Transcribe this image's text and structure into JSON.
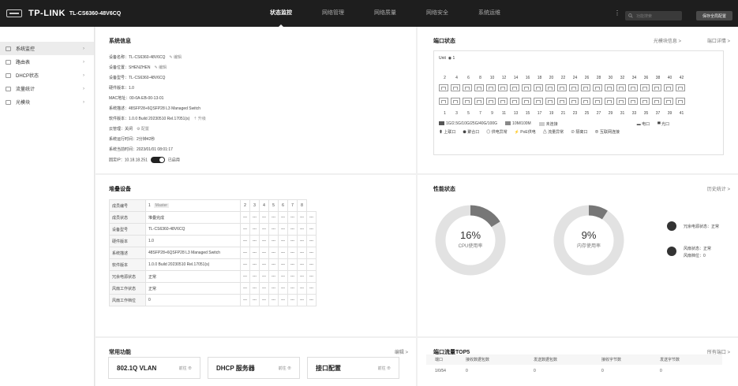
{
  "header": {
    "brand": "TP-LINK",
    "model": "TL-CS6360-48V6CQ",
    "nav": [
      "状态监控",
      "网络管理",
      "网络质量",
      "网络安全",
      "系统运维"
    ],
    "search_placeholder": "功能搜索",
    "save_label": "保存全局配置"
  },
  "sidebar": {
    "items": [
      {
        "label": "系统监控",
        "icon": "monitor-icon"
      },
      {
        "label": "路由表",
        "icon": "route-table-icon"
      },
      {
        "label": "DHCP状态",
        "icon": "dhcp-icon"
      },
      {
        "label": "流量统计",
        "icon": "traffic-icon"
      },
      {
        "label": "光模块",
        "icon": "optical-module-icon"
      }
    ]
  },
  "sysinfo": {
    "title": "系统信息",
    "edit_label": "编辑",
    "upgrade_label": "升级",
    "config_label": "配置",
    "enabled_label": "已启用",
    "rows": [
      "设备名称：TL-CS6360-48V6CQ",
      "设备位置：SHENZHEN",
      "设备型号：TL-CS6360-48V6CQ",
      "硬件版本：1.0",
      "MAC地址：00-0A-EB-00-13-01",
      "系统描述：48SFP28+6QSFP28 L3 Managed Switch",
      "软件版本：1.0.0 Build 20230510 Rel.17051(s)",
      "云管理：关闭",
      "系统运行时间：2分钟42秒",
      "系统当前时间：2023/01/01 08:01:17",
      "固定IP：10.18.18.251"
    ]
  },
  "ports": {
    "title": "端口状态",
    "link_optical": "光模块信息 >",
    "link_detail": "端口详情 >",
    "unit_label": "Unit",
    "unit_value": "1",
    "top_numbers": [
      "2",
      "4",
      "6",
      "8",
      "10",
      "12",
      "14",
      "16",
      "18",
      "20",
      "22",
      "24",
      "26",
      "28",
      "30",
      "32",
      "34",
      "36",
      "38",
      "40",
      "42"
    ],
    "bottom_numbers": [
      "1",
      "3",
      "5",
      "7",
      "9",
      "11",
      "13",
      "15",
      "17",
      "19",
      "21",
      "23",
      "25",
      "27",
      "29",
      "31",
      "33",
      "35",
      "37",
      "39",
      "41"
    ],
    "legend1": [
      "1G/2.5G/10G/25G/40G/100G",
      "10M/100M",
      "未连接",
      "电口",
      "光口"
    ],
    "legend2": [
      "上联口",
      "聚合口",
      "供电异常",
      "PoE供电",
      "流量异常",
      "隔离口",
      "互联网连接"
    ]
  },
  "stack": {
    "title": "堆叠设备",
    "members": [
      "1",
      "2",
      "3",
      "4",
      "5",
      "6",
      "7",
      "8"
    ],
    "master_badge": "Master",
    "rows": [
      {
        "label": "成员编号",
        "value": "1"
      },
      {
        "label": "成员状态",
        "value": "堆叠完成"
      },
      {
        "label": "设备型号",
        "value": "TL-CS6360-48V6CQ"
      },
      {
        "label": "硬件版本",
        "value": "1.0"
      },
      {
        "label": "系统描述",
        "value": "48SFP28+6QSFP28 L3 Managed Switch"
      },
      {
        "label": "软件版本",
        "value": "1.0.0 Build 20230510 Rel.17051(s)"
      },
      {
        "label": "冗余电源状态",
        "value": "正常"
      },
      {
        "label": "风扇工作状态",
        "value": "正常"
      },
      {
        "label": "风扇工作档位",
        "value": "0"
      }
    ],
    "empty": "---"
  },
  "perf": {
    "title": "性能状态",
    "link": "历史统计 >",
    "cpu_value": "16%",
    "cpu_fraction": 0.16,
    "cpu_label": "CPU使用率",
    "mem_value": "9%",
    "mem_fraction": 0.09,
    "mem_label": "内存使用率",
    "psu_status": "冗余电源状态：正常",
    "fan_status": "风扇状态：正常",
    "fan_level": "风扇档位：0"
  },
  "functions": {
    "title": "常用功能",
    "edit": "编辑 >",
    "go": "前往",
    "items": [
      "802.1Q VLAN",
      "DHCP 服务器",
      "接口配置"
    ]
  },
  "traffic": {
    "title": "端口流量TOP5",
    "link": "所有端口 >",
    "headers": [
      "端口",
      "接收数据包数",
      "发送数据包数",
      "接收字节数",
      "发送字节数"
    ],
    "rows": [
      [
        "1/0/54",
        "0",
        "0",
        "0",
        "0"
      ]
    ]
  },
  "colors": {
    "topbar": "#1e1e1e",
    "accent": "#222222",
    "gauge_fill": "#777777",
    "gauge_track": "#e2e2e2"
  }
}
